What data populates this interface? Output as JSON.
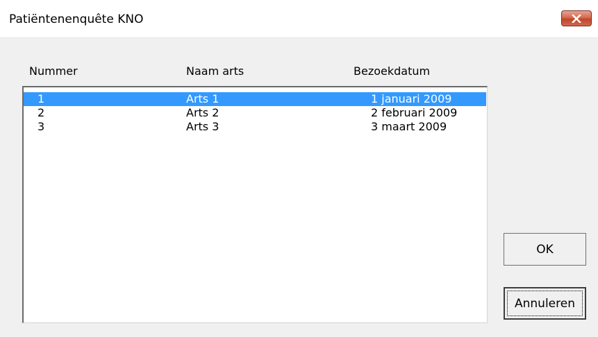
{
  "window": {
    "title": "Patiëntenenquête KNO"
  },
  "icons": {
    "close": "close-icon"
  },
  "list": {
    "columns": [
      "Nummer",
      "Naam arts",
      "Bezoekdatum"
    ],
    "rows": [
      {
        "nummer": "1",
        "naam": "Arts 1",
        "datum": "1 januari 2009",
        "selected": true
      },
      {
        "nummer": "2",
        "naam": "Arts 2",
        "datum": "2 februari 2009",
        "selected": false
      },
      {
        "nummer": "3",
        "naam": "Arts 3",
        "datum": "3 maart 2009",
        "selected": false
      }
    ],
    "selection_color": "#3399ff"
  },
  "buttons": {
    "ok_label": "OK",
    "cancel_label": "Annuleren"
  }
}
